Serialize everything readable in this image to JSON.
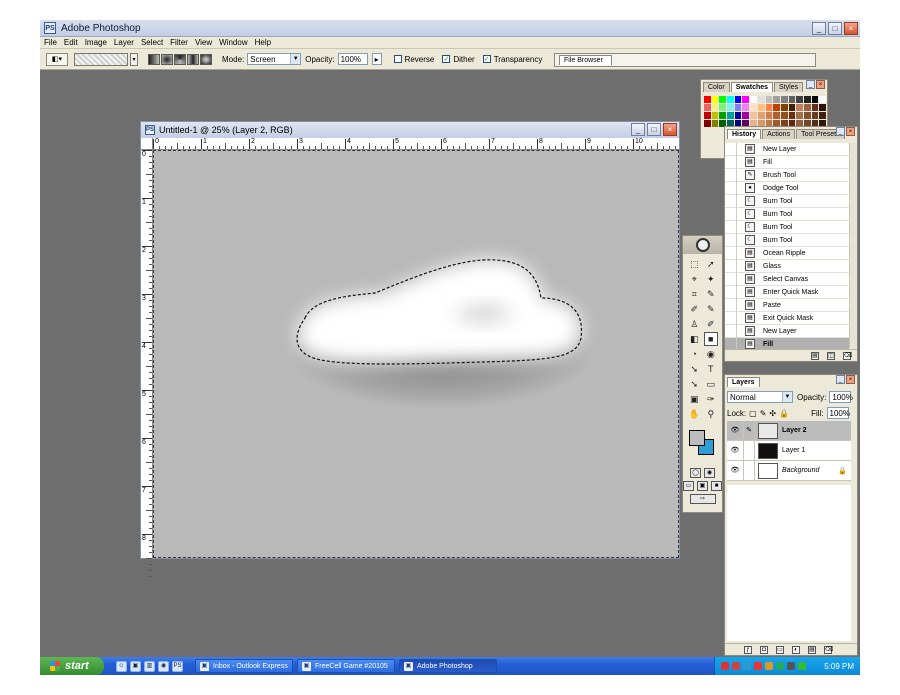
{
  "app": {
    "title": "Adobe Photoshop",
    "icon_letter": "PS"
  },
  "window_controls": {
    "minimize": "_",
    "maximize": "□",
    "close": "×"
  },
  "menu": [
    "File",
    "Edit",
    "Image",
    "Layer",
    "Select",
    "Filter",
    "View",
    "Window",
    "Help"
  ],
  "options_bar": {
    "mode_label": "Mode:",
    "mode_value": "Screen",
    "opacity_label": "Opacity:",
    "opacity_value": "100%",
    "reverse_label": "Reverse",
    "reverse_checked": false,
    "dither_label": "Dither",
    "dither_checked": true,
    "transparency_label": "Transparency",
    "transparency_checked": true,
    "file_browser_label": "File Browser"
  },
  "document": {
    "title": "Untitled-1 @ 25% (Layer 2, RGB)",
    "ruler_top_labels": [
      "0",
      "1",
      "2",
      "3",
      "4",
      "5",
      "6",
      "7",
      "8",
      "9",
      "10"
    ],
    "ruler_left_labels": [
      "0",
      "1",
      "2",
      "3",
      "4",
      "5",
      "6",
      "7",
      "8"
    ]
  },
  "swatches_panel": {
    "tabs": [
      "Color",
      "Swatches",
      "Styles"
    ],
    "active_tab": "Swatches",
    "colors": [
      "#ff0000",
      "#ffff00",
      "#00ff00",
      "#00ffff",
      "#0000ff",
      "#ff00ff",
      "#ffffff",
      "#e0e0e0",
      "#c0c0c0",
      "#a0a0a0",
      "#808080",
      "#606060",
      "#404040",
      "#202020",
      "#000000",
      "#ffffff",
      "#f06060",
      "#f8f080",
      "#80f080",
      "#80f0f0",
      "#8080f0",
      "#f080f0",
      "#ffe0c0",
      "#ffc080",
      "#ff8040",
      "#c04000",
      "#804000",
      "#402000",
      "#c08060",
      "#a06040",
      "#603020",
      "#301000",
      "#c00000",
      "#c0c000",
      "#00a000",
      "#00a0a0",
      "#0000a0",
      "#a000a0",
      "#f0c0a0",
      "#e0a070",
      "#d08050",
      "#b06030",
      "#905020",
      "#703010",
      "#a07050",
      "#805030",
      "#604020",
      "#402010",
      "#800000",
      "#808000",
      "#006000",
      "#006060",
      "#000080",
      "#600060",
      "#e8b090",
      "#d89868",
      "#c07848",
      "#a05830",
      "#804020",
      "#602810",
      "#906040",
      "#704828",
      "#503018",
      "#301808"
    ]
  },
  "history_panel": {
    "tabs": [
      "History",
      "Actions",
      "Tool Presets"
    ],
    "active_tab": "History",
    "items": [
      {
        "label": "New Layer",
        "icon": "doc-icon"
      },
      {
        "label": "Fill",
        "icon": "doc-icon"
      },
      {
        "label": "Brush Tool",
        "icon": "brush-icon"
      },
      {
        "label": "Dodge Tool",
        "icon": "dodge-icon"
      },
      {
        "label": "Burn Tool",
        "icon": "burn-icon"
      },
      {
        "label": "Burn Tool",
        "icon": "burn-icon"
      },
      {
        "label": "Burn Tool",
        "icon": "burn-icon"
      },
      {
        "label": "Burn Tool",
        "icon": "burn-icon"
      },
      {
        "label": "Ocean Ripple",
        "icon": "doc-icon"
      },
      {
        "label": "Glass",
        "icon": "doc-icon"
      },
      {
        "label": "Select Canvas",
        "icon": "doc-icon"
      },
      {
        "label": "Enter Quick Mask",
        "icon": "doc-icon"
      },
      {
        "label": "Paste",
        "icon": "doc-icon"
      },
      {
        "label": "Exit Quick Mask",
        "icon": "doc-icon"
      },
      {
        "label": "New Layer",
        "icon": "doc-icon"
      },
      {
        "label": "Fill",
        "icon": "doc-icon",
        "selected": true
      }
    ]
  },
  "toolbox": {
    "tools": [
      "⬚",
      "➚",
      "⌖",
      "✦",
      "⌗",
      "✎",
      "✐",
      "✎",
      "♙",
      "✐",
      "◧",
      "■",
      "◔",
      "◉",
      "➘",
      "T",
      "➘",
      "▭",
      "▣",
      "✑",
      "✋",
      "⚲"
    ]
  },
  "layers_panel": {
    "tab": "Layers",
    "blend_mode": "Normal",
    "opacity_label": "Opacity:",
    "opacity_value": "100%",
    "lock_label": "Lock:",
    "fill_label": "Fill:",
    "fill_value": "100%",
    "layers": [
      {
        "name": "Layer 2",
        "selected": true,
        "thumb": "#e8e8e8"
      },
      {
        "name": "Layer 1",
        "selected": false,
        "thumb": "#111111"
      },
      {
        "name": "Background",
        "selected": false,
        "thumb": "#ffffff",
        "locked": true
      }
    ]
  },
  "taskbar": {
    "start_label": "start",
    "tasks": [
      {
        "label": "Inbox - Outlook Express",
        "active": false
      },
      {
        "label": "FreeCell Game #20105",
        "active": false
      },
      {
        "label": "Adobe Photoshop",
        "active": true
      }
    ],
    "clock": "5:09 PM",
    "tray_colors": [
      "#d33",
      "#c44",
      "#39c",
      "#e33",
      "#d92",
      "#2a6",
      "#555",
      "#3b3"
    ]
  }
}
